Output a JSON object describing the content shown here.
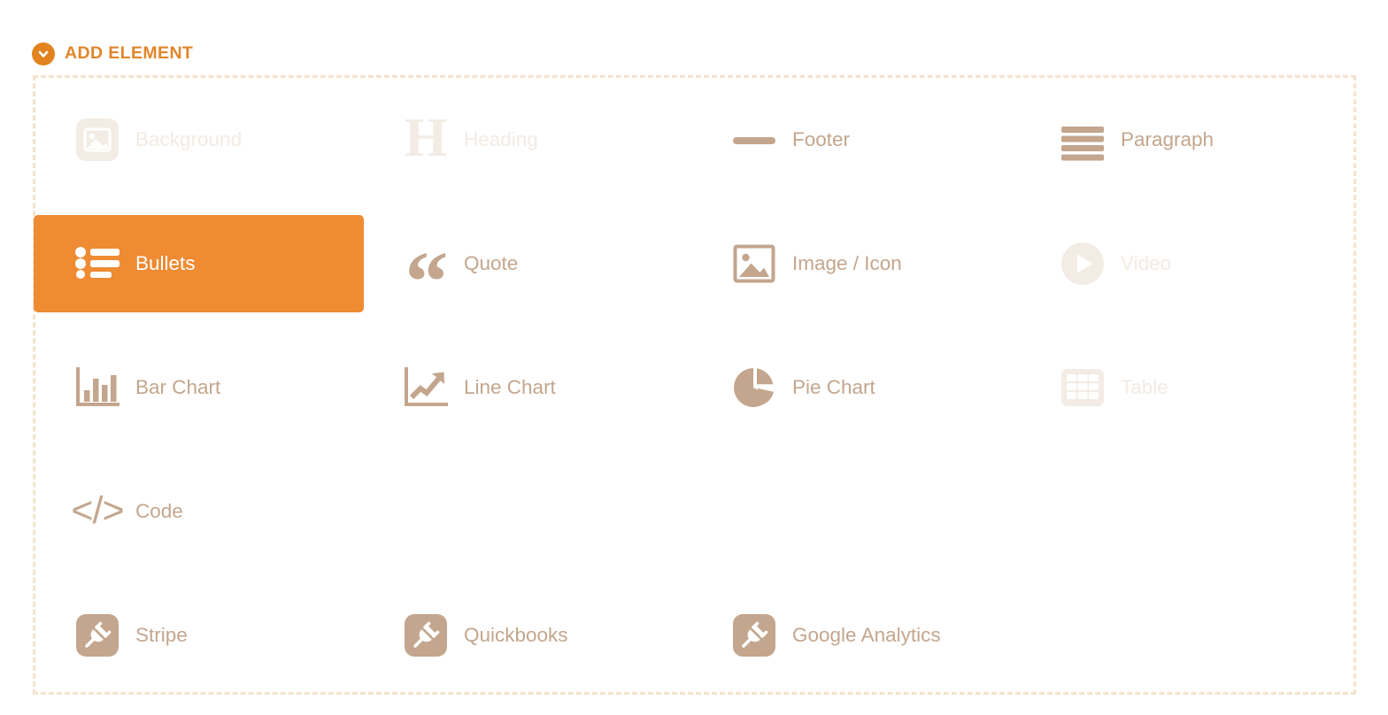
{
  "header": {
    "title": "ADD ELEMENT",
    "toggle_icon": "chevron-down-circle-icon",
    "accent_color": "#e2852a"
  },
  "theme": {
    "accent_orange": "#ee8b33",
    "header_orange": "#e2852a",
    "active_tan": "#c3a68d",
    "disabled_tan": "#f3ece4",
    "dashed_border": "#f4e2cc",
    "background": "#ffffff",
    "selected_text": "#ffffff"
  },
  "palette": {
    "rows": [
      [
        {
          "label": "Background",
          "icon": "image-rounded-icon",
          "state": "disabled"
        },
        {
          "label": "Heading",
          "icon": "heading-h-icon",
          "state": "disabled"
        },
        {
          "label": "Footer",
          "icon": "footer-bar-icon",
          "state": "active"
        },
        {
          "label": "Paragraph",
          "icon": "paragraph-lines-icon",
          "state": "active"
        }
      ],
      [
        {
          "label": "Bullets",
          "icon": "bulleted-list-icon",
          "state": "selected"
        },
        {
          "label": "Quote",
          "icon": "quote-marks-icon",
          "state": "active"
        },
        {
          "label": "Image / Icon",
          "icon": "image-frame-icon",
          "state": "active"
        },
        {
          "label": "Video",
          "icon": "play-circle-icon",
          "state": "disabled"
        }
      ],
      [
        {
          "label": "Bar Chart",
          "icon": "bar-chart-icon",
          "state": "active"
        },
        {
          "label": "Line Chart",
          "icon": "line-chart-icon",
          "state": "active"
        },
        {
          "label": "Pie Chart",
          "icon": "pie-chart-icon",
          "state": "active"
        },
        {
          "label": "Table",
          "icon": "table-grid-icon",
          "state": "disabled"
        }
      ],
      [
        {
          "label": "Code",
          "icon": "code-brackets-icon",
          "state": "active"
        },
        {
          "label": "",
          "icon": "",
          "state": "empty"
        },
        {
          "label": "",
          "icon": "",
          "state": "empty"
        },
        {
          "label": "",
          "icon": "",
          "state": "empty"
        }
      ],
      [
        {
          "label": "Stripe",
          "icon": "plug-rounded-icon",
          "state": "active"
        },
        {
          "label": "Quickbooks",
          "icon": "plug-rounded-icon",
          "state": "active"
        },
        {
          "label": "Google Analytics",
          "icon": "plug-rounded-icon",
          "state": "active"
        },
        {
          "label": "",
          "icon": "",
          "state": "empty"
        }
      ]
    ]
  }
}
